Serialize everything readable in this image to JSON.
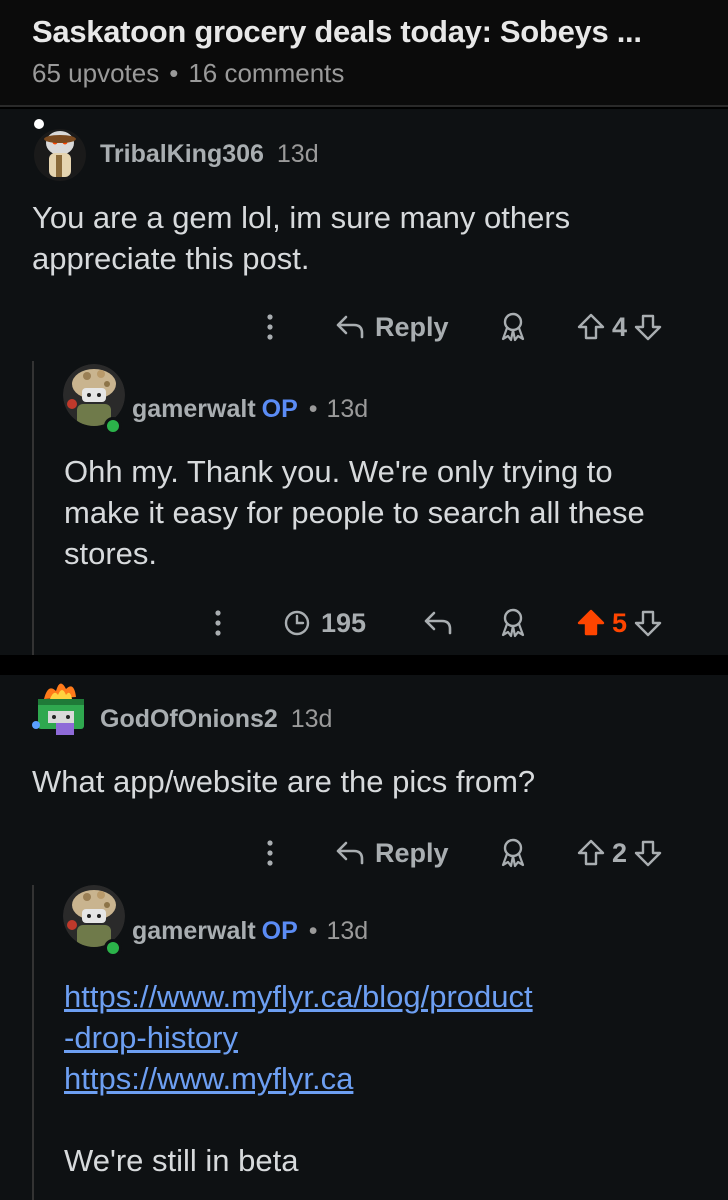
{
  "post": {
    "title": "Saskatoon grocery deals today: Sobeys ...",
    "upvotes": "65 upvotes",
    "separator": "•",
    "comments": "16 comments"
  },
  "comments": [
    {
      "author": "TribalKing306",
      "time": "13d",
      "body": "You are a gem lol, im sure many others appreciate this post.",
      "reply_label": "Reply",
      "score": "4"
    },
    {
      "author": "gamerwalt",
      "op_tag": "OP",
      "separator": "•",
      "time": "13d",
      "body": "Ohh my. Thank you. We're only trying to make it easy for people to search all these stores.",
      "views": "195",
      "score": "5"
    },
    {
      "author": "GodOfOnions2",
      "time": "13d",
      "body": "What app/website are the pics from?",
      "reply_label": "Reply",
      "score": "2"
    },
    {
      "author": "gamerwalt",
      "op_tag": "OP",
      "separator": "•",
      "time": "13d",
      "link1_line1": "https://www.myflyr.ca/blog/product",
      "link1_line2": "-drop-history",
      "link2": "https://www.myflyr.ca",
      "body_tail": "We're still in beta"
    }
  ],
  "colors": {
    "background": "#0e1113",
    "op_blue": "#5b8cf5",
    "link_blue": "#6d9ff2",
    "upvoted_orange": "#ff4500",
    "online_green": "#2bb34a"
  },
  "icons": [
    "more-vertical-icon",
    "reply-arrow-icon",
    "award-icon",
    "upvote-icon",
    "downvote-icon",
    "views-icon"
  ]
}
